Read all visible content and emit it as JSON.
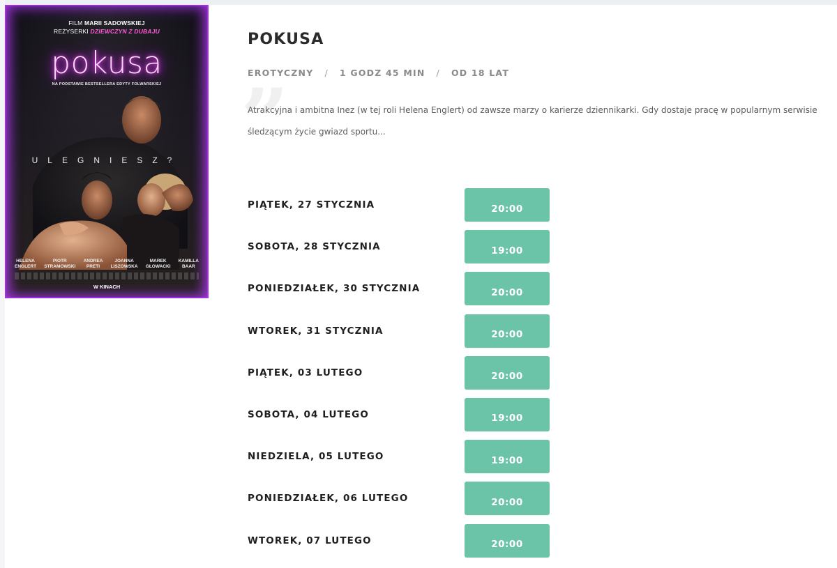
{
  "poster": {
    "director_line_prefix": "FILM",
    "director_name": "MARII SADOWSKIEJ",
    "director_line2_prefix": "REŻYSERKI",
    "director_line2_film": "DZIEWCZYN Z DUBAJU",
    "title": "pokusa",
    "subtitle": "NA PODSTAWIE BESTSELLERA EDYTY FOLWARSKIEJ",
    "tagline": "ULEGNIESZ?",
    "cast": [
      {
        "first": "HELENA",
        "last": "ENGLERT"
      },
      {
        "first": "PIOTR",
        "last": "STRAMOWSKI"
      },
      {
        "first": "ANDREA",
        "last": "PRETI"
      },
      {
        "first": "JOANNA",
        "last": "LISZOWSKA"
      },
      {
        "first": "MAREK",
        "last": "GŁOWACKI"
      },
      {
        "first": "KAMILLA",
        "last": "BAAR"
      }
    ],
    "release": "W KINACH"
  },
  "movie": {
    "title": "POKUSA",
    "genre": "EROTYCZNY",
    "duration": "1 GODZ 45 MIN",
    "rating": "OD 18 LAT",
    "separator": "/",
    "quote_mark": "”",
    "description": "Atrakcyjna i ambitna Inez (w tej roli Helena Englert) od zawsze marzy o karierze dziennikarki. Gdy dostaje pracę w popularnym serwisie śledzącym życie gwiazd sportu..."
  },
  "schedule": [
    {
      "date": "PIĄTEK, 27 STYCZNIA",
      "time": "20:00"
    },
    {
      "date": "SOBOTA, 28 STYCZNIA",
      "time": "19:00"
    },
    {
      "date": "PONIEDZIAŁEK, 30 STYCZNIA",
      "time": "20:00"
    },
    {
      "date": "WTOREK, 31 STYCZNIA",
      "time": "20:00"
    },
    {
      "date": "PIĄTEK, 03 LUTEGO",
      "time": "20:00"
    },
    {
      "date": "SOBOTA, 04 LUTEGO",
      "time": "19:00"
    },
    {
      "date": "NIEDZIELA, 05 LUTEGO",
      "time": "19:00"
    },
    {
      "date": "PONIEDZIAŁEK, 06 LUTEGO",
      "time": "20:00"
    },
    {
      "date": "WTOREK, 07 LUTEGO",
      "time": "20:00"
    }
  ],
  "colors": {
    "button_bg": "#6cc4a8",
    "title_neon": "#ff46e6",
    "poster_border": "#8a2bd0"
  }
}
